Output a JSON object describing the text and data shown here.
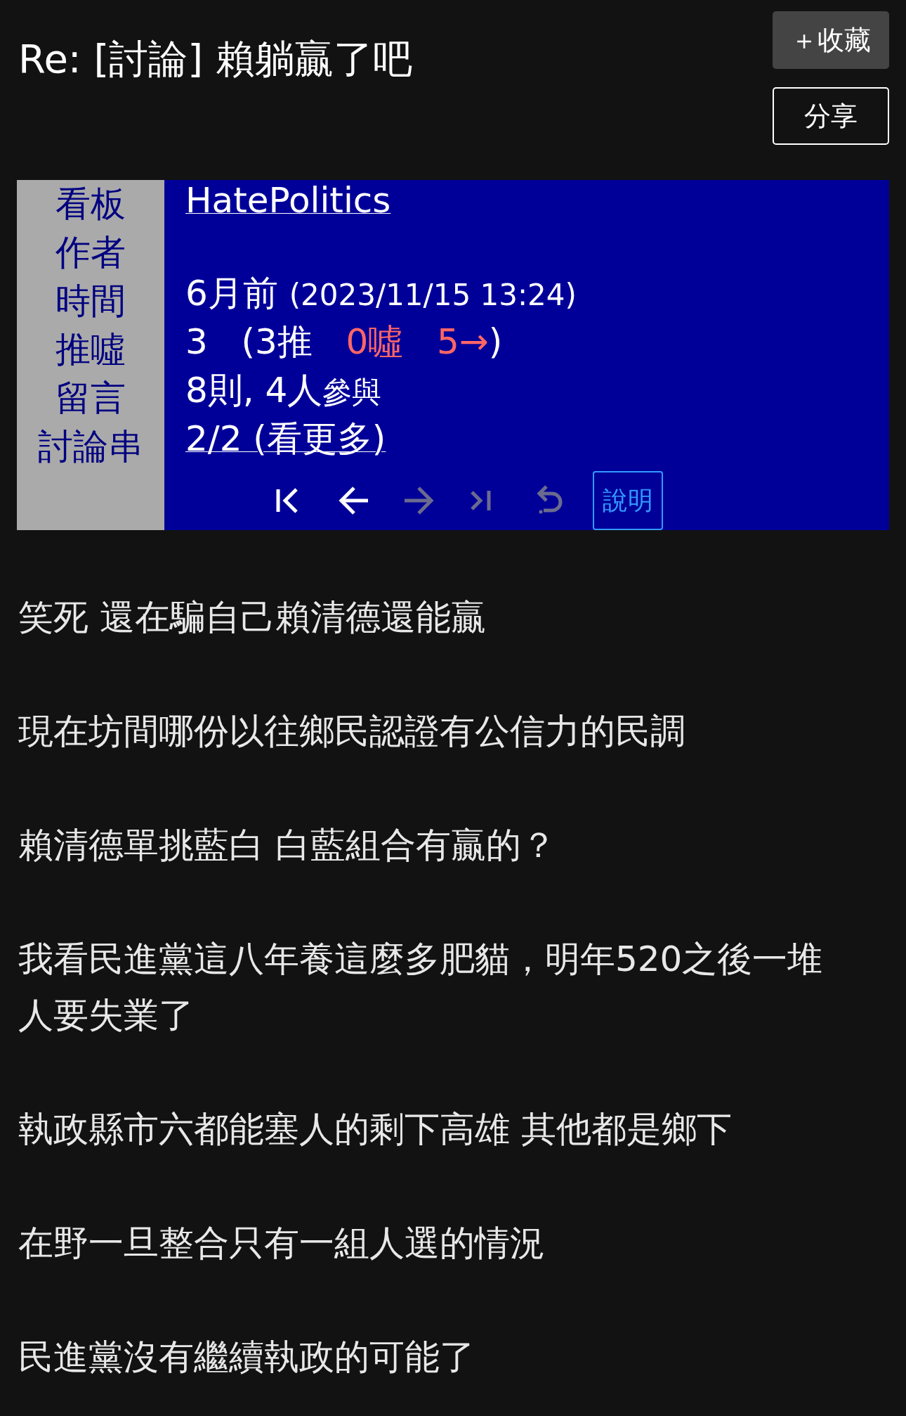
{
  "title": "Re: [討論] 賴躺贏了吧",
  "buttons": [
    {
      "kind": "favorite",
      "label": "＋收藏"
    },
    {
      "kind": "share",
      "label": "分享"
    }
  ],
  "info": [
    {
      "label": "看板",
      "kind": "link",
      "segments": [
        {
          "text": "HatePolitics",
          "kind": "normal"
        }
      ]
    },
    {
      "label": "作者"
    },
    {
      "label": "時間",
      "kind": "text",
      "segments": [
        {
          "text": "6月前 ",
          "kind": "normal"
        },
        {
          "text": "(2023/11/15 13:24)",
          "kind": "small"
        }
      ]
    },
    {
      "label": "推噓",
      "kind": "text",
      "segments": [
        {
          "text": "3   (3推   ",
          "kind": "normal"
        },
        {
          "text": "0噓   5→",
          "kind": "normal",
          "color": "#ff6666"
        },
        {
          "text": ")",
          "kind": "normal"
        }
      ]
    },
    {
      "label": "留言",
      "kind": "text",
      "segments": [
        {
          "text": "8則, 4人",
          "kind": "normal"
        },
        {
          "text": "參與",
          "kind": "small"
        }
      ]
    },
    {
      "label": "討論串",
      "kind": "link",
      "segments": [
        {
          "text": "2/2 (看更多)",
          "kind": "normal"
        }
      ]
    }
  ],
  "nav": [
    {
      "kind": "first",
      "disabled": false
    },
    {
      "kind": "prev",
      "disabled": false
    },
    {
      "kind": "next",
      "disabled": true
    },
    {
      "kind": "last",
      "disabled": true
    },
    {
      "kind": "back",
      "disabled": true
    }
  ],
  "help_button": "說明",
  "body": [
    "笑死 還在騙自己賴清德還能贏",
    "現在坊間哪份以往鄉民認證有公信力的民調",
    "賴清德單挑藍白 白藍組合有贏的？",
    "我看民進黨這八年養這麼多肥貓，明年520之後一堆人要失業了",
    "執政縣市六都能塞人的剩下高雄 其他都是鄉下",
    "在野一旦整合只有一組人選的情況",
    "民進黨沒有繼續執政的可能了"
  ]
}
